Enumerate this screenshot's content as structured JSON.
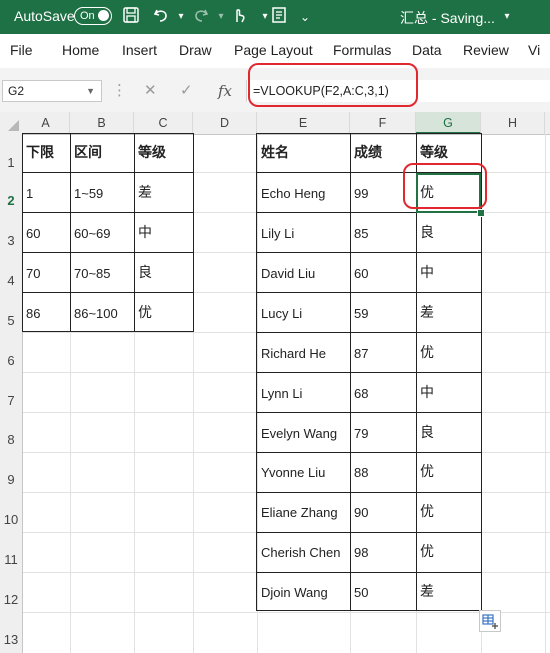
{
  "titlebar": {
    "autosave_label": "AutoSave",
    "autosave_state": "On",
    "file_status": "汇总 - Saving...",
    "accent_color": "#1e7145"
  },
  "menu": [
    "File",
    "Home",
    "Insert",
    "Draw",
    "Page Layout",
    "Formulas",
    "Data",
    "Review",
    "Vi"
  ],
  "namebox": {
    "value": "G2"
  },
  "formula_bar": {
    "cancel_icon": "✕",
    "enter_icon": "✓",
    "fx_label": "fx",
    "formula": "=VLOOKUP(F2,A:C,3,1)"
  },
  "columns": [
    "A",
    "B",
    "C",
    "D",
    "E",
    "F",
    "G",
    "H"
  ],
  "selected_column": "G",
  "rows": [
    "1",
    "2",
    "3",
    "4",
    "5",
    "6",
    "7",
    "8",
    "9",
    "10",
    "11",
    "12",
    "13"
  ],
  "selected_row": "2",
  "lookup_table": {
    "headers": [
      "下限",
      "区间",
      "等级"
    ],
    "rows": [
      [
        "1",
        "1~59",
        "差"
      ],
      [
        "60",
        "60~69",
        "中"
      ],
      [
        "70",
        "70~85",
        "良"
      ],
      [
        "86",
        "86~100",
        "优"
      ]
    ]
  },
  "score_table": {
    "headers": [
      "姓名",
      "成绩",
      "等级"
    ],
    "rows": [
      [
        "Echo Heng",
        "99",
        "优"
      ],
      [
        "Lily Li",
        "85",
        "良"
      ],
      [
        "David Liu",
        "60",
        "中"
      ],
      [
        "Lucy Li",
        "59",
        "差"
      ],
      [
        "Richard He",
        "87",
        "优"
      ],
      [
        "Lynn Li",
        "68",
        "中"
      ],
      [
        "Evelyn Wang",
        "79",
        "良"
      ],
      [
        "Yvonne Liu",
        "88",
        "优"
      ],
      [
        "Eliane Zhang",
        "90",
        "优"
      ],
      [
        "Cherish Chen",
        "98",
        "优"
      ],
      [
        "Djoin Wang",
        "50",
        "差"
      ]
    ]
  },
  "highlight_color": "#e0282e"
}
